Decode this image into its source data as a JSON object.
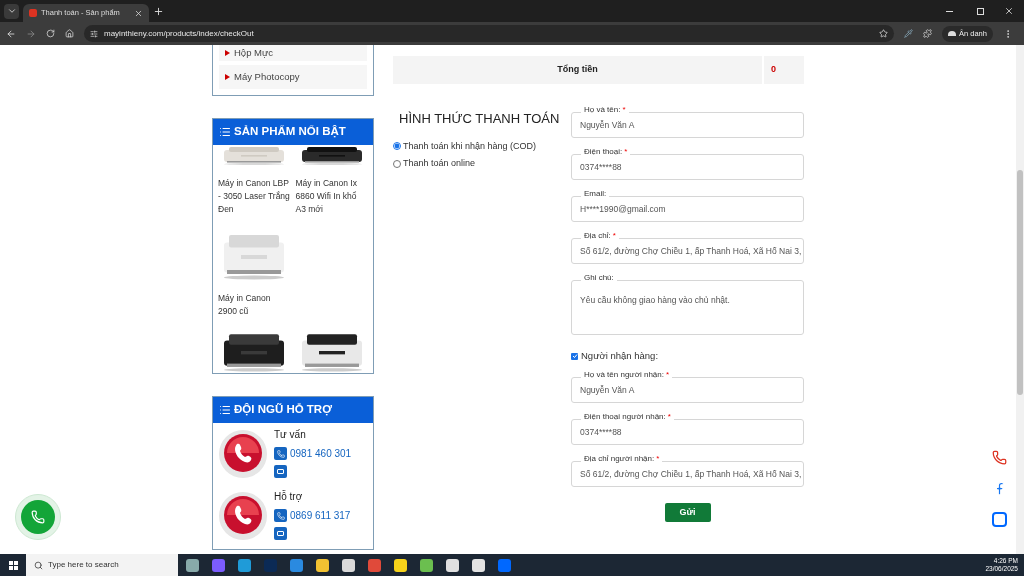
{
  "browser": {
    "tabs": [
      {
        "title": "Thanh toán - Sản phẩm",
        "selected": true
      }
    ],
    "url": "mayinthieny.com/products/index/checkOut",
    "profile": "Ẩn danh"
  },
  "sidebar": {
    "categories": [
      {
        "label": "Hộp Mực"
      },
      {
        "label": "Máy Photocopy"
      }
    ],
    "featured": {
      "title": "SẢN PHẨM NỔI BẬT",
      "products": [
        {
          "name": "Máy in Canon LBP - 3050 Laser Trắng Đen"
        },
        {
          "name": "Máy in Canon Ix 6860 Wifi In khổ A3 mới"
        },
        {
          "name": "Máy in Canon 2900 cũ"
        },
        {
          "kind": "picture"
        },
        {
          "kind": "picture"
        }
      ]
    },
    "support": {
      "title": "ĐỘI NGŨ HỖ TRỢ",
      "contacts": [
        {
          "role": "Tư vấn",
          "phone": "0981 460 301"
        },
        {
          "role": "Hỗ trợ",
          "phone": "0869 611 317"
        }
      ]
    }
  },
  "total": {
    "label": "Tổng tiền",
    "value": "0"
  },
  "payment": {
    "title": "HÌNH THỨC THANH TOÁN",
    "options": [
      {
        "label": "Thanh toán khi nhận hàng (COD)",
        "selected": true
      },
      {
        "label": "Thanh toán online",
        "selected": false
      }
    ]
  },
  "form": {
    "fields": [
      {
        "kind": "input",
        "label": "Họ và tên:",
        "mark": "*",
        "value": "Nguyễn Văn A"
      },
      {
        "kind": "input",
        "label": "Điện thoại:",
        "mark": "*",
        "value": "0374****88"
      },
      {
        "kind": "input",
        "label": "Email:",
        "value": "H****1990@gmail.com"
      },
      {
        "kind": "input",
        "label": "Địa chỉ:",
        "mark": "*",
        "value": "Số 61/2, đường Chợ Chiều 1, ấp Thanh Hoá, Xã Hố Nai 3,"
      },
      {
        "kind": "textarea",
        "label": "Ghi chú:",
        "value": "Yêu cầu không giao hàng vào chủ nhật."
      }
    ],
    "recipient": {
      "label": "Người nhận hàng:",
      "checked": true,
      "fields": [
        {
          "kind": "input",
          "label": "Họ và tên người nhận:",
          "mark": "*",
          "value": "Nguyễn Văn A"
        },
        {
          "kind": "input",
          "label": "Điện thoại người nhận:",
          "mark": "*",
          "value": "0374****88"
        },
        {
          "kind": "input",
          "label": "Địa chỉ người nhận:",
          "mark": "*",
          "value": "Số 61/2, đường Chợ Chiều 1, ấp Thanh Hoá, Xã Hố Nai 3,"
        }
      ]
    },
    "submit": "Gửi"
  },
  "taskbar": {
    "search_placeholder": "Type here to search",
    "time": "4:26 PM",
    "date": "23/06/2025"
  }
}
